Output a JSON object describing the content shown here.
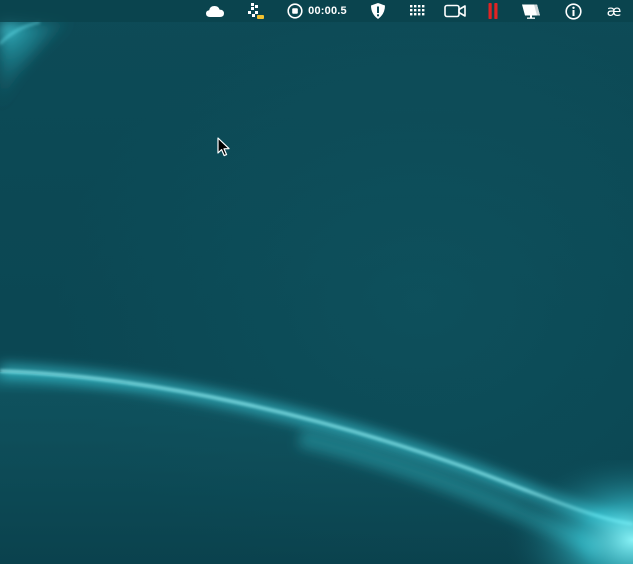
{
  "menubar": {
    "recorder": {
      "timer": "00:00.5"
    },
    "language": {
      "label": "æ"
    },
    "icons": [
      "cloud-icon",
      "dropbox-sync-icon",
      "record-stop-icon",
      "shield-alert-icon",
      "grid-dots-icon",
      "video-camera-icon",
      "red-pause-bars-icon",
      "display-notification-icon",
      "info-circle-icon"
    ]
  },
  "colors": {
    "background": "#0b4753",
    "glow": "#5ff3ff",
    "pause_accent": "#e02424"
  }
}
